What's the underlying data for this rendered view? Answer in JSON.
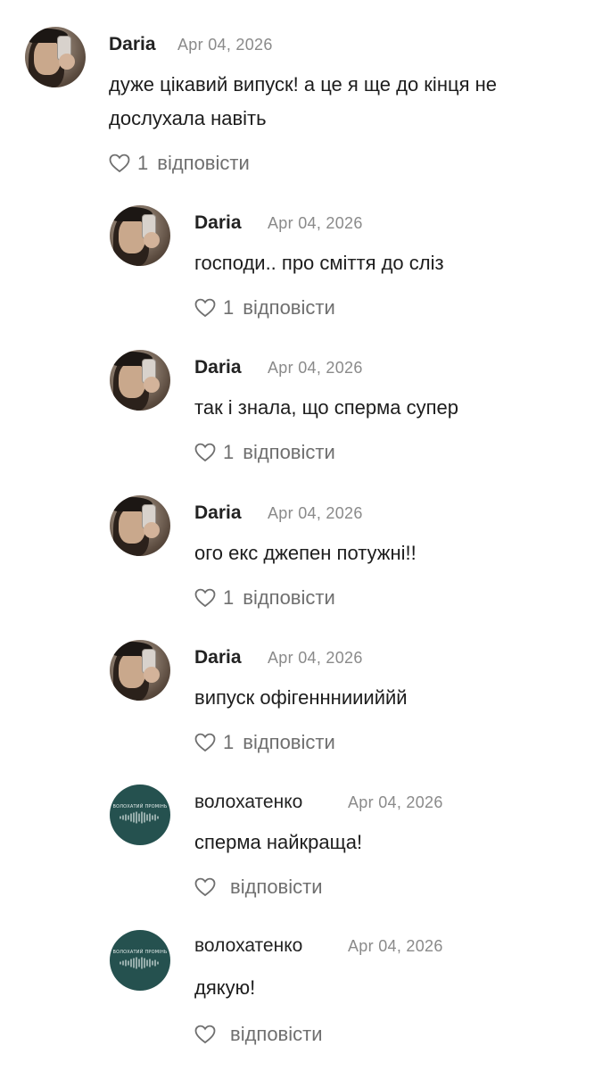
{
  "comments": [
    {
      "author": "Daria",
      "date": "Apr 04, 2026",
      "text_lines": [
        "дуже цікавий випуск! а це я ще до кінця не",
        "дослухала навіть"
      ],
      "likes": "1",
      "reply_label": "відповісти",
      "avatar": "photo"
    },
    {
      "author": "Daria",
      "date": "Apr 04, 2026",
      "text_lines": [
        "господи.. про сміття до сліз"
      ],
      "likes": "1",
      "reply_label": "відповісти",
      "avatar": "photo"
    },
    {
      "author": "Daria",
      "date": "Apr 04, 2026",
      "text_lines": [
        "так і знала, що сперма супер"
      ],
      "likes": "1",
      "reply_label": "відповісти",
      "avatar": "photo"
    },
    {
      "author": "Daria",
      "date": "Apr 04, 2026",
      "text_lines": [
        "ого екс джепен потужні!!"
      ],
      "likes": "1",
      "reply_label": "відповісти",
      "avatar": "photo"
    },
    {
      "author": "Daria",
      "date": "Apr 04, 2026",
      "text_lines": [
        "випуск офігеннниииййй"
      ],
      "likes": "1",
      "reply_label": "відповісти",
      "avatar": "photo"
    },
    {
      "author": "волохатенко",
      "date": "Apr 04, 2026",
      "text_lines": [
        "сперма найкраща!"
      ],
      "likes": "",
      "reply_label": "відповісти",
      "avatar": "podcast",
      "avatar_label": "ВОЛОХАТИЙ ПРОМІНЬ"
    },
    {
      "author": "волохатенко",
      "date": "Apr 04, 2026",
      "text_lines": [
        "дякую!"
      ],
      "likes": "",
      "reply_label": "відповісти",
      "avatar": "podcast",
      "avatar_label": "ВОЛОХАТИЙ ПРОМІНЬ"
    }
  ],
  "colors": {
    "podcast_avatar_bg": "#25514f",
    "muted_text": "#8a8a8a",
    "action_text": "#6f6f6f"
  },
  "icons": {
    "like": "heart-outline-icon"
  }
}
